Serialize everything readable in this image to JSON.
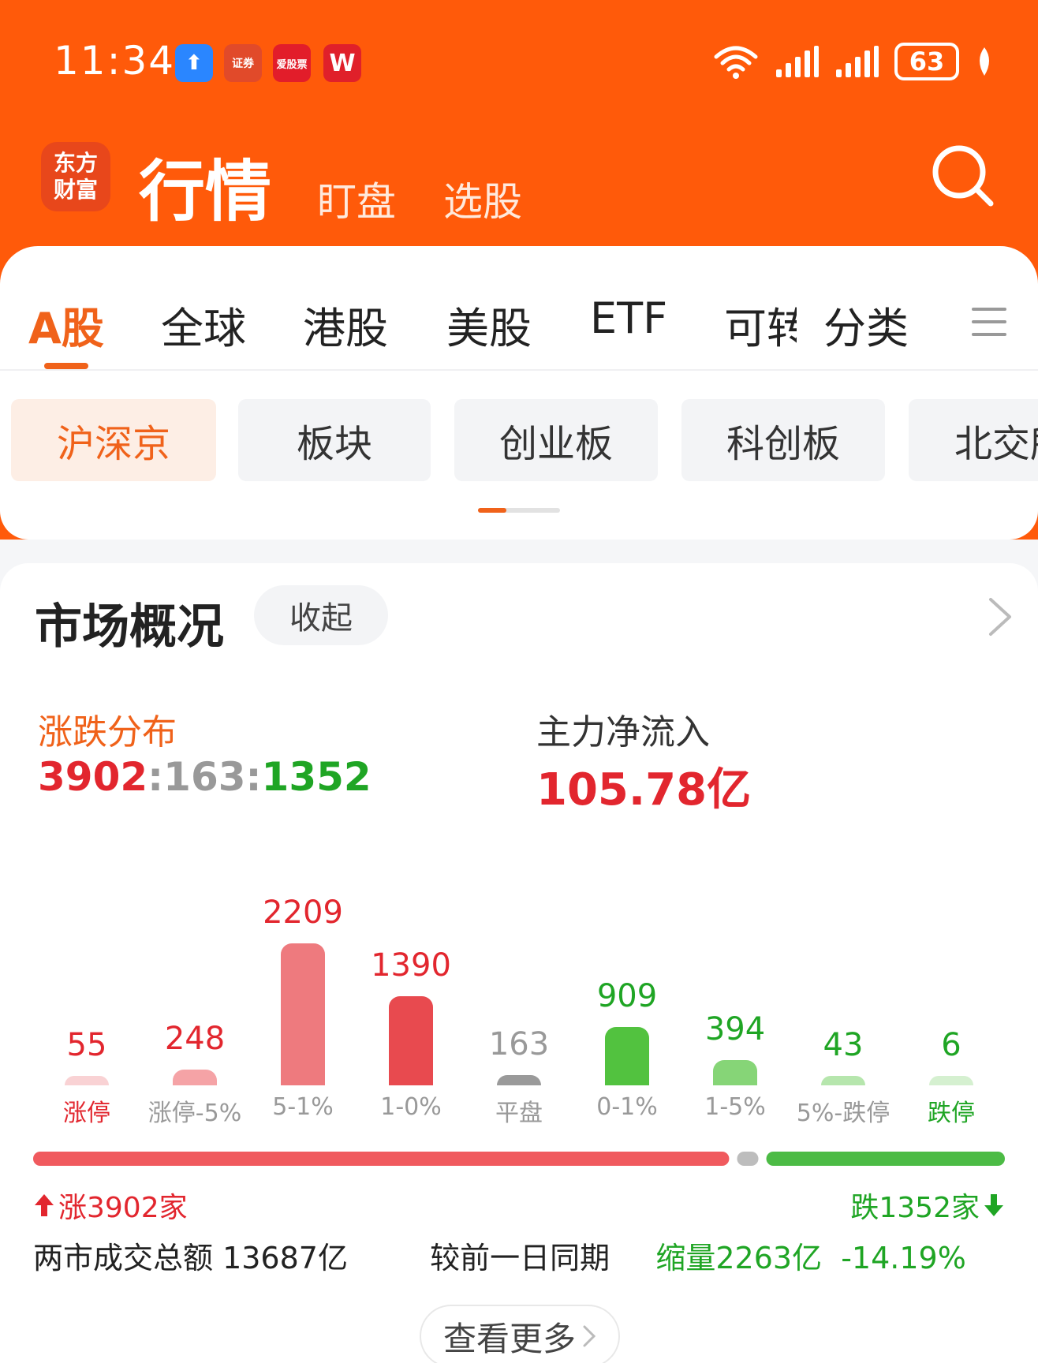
{
  "status_bar": {
    "time": "11:34",
    "app_icons": [
      {
        "name": "upload-icon",
        "label": "⬆",
        "color": "#2a86ff"
      },
      {
        "name": "zhengquan-app-icon",
        "label": "证券",
        "color": "#e14a2a"
      },
      {
        "name": "aigupiao-app-icon",
        "label": "爱股票",
        "color": "#e21d2a"
      },
      {
        "name": "w-app-icon",
        "label": "W",
        "color": "#e0202a"
      }
    ],
    "battery": "63"
  },
  "header": {
    "logo_line1": "东方",
    "logo_line2": "财富",
    "title": "行情",
    "sub_tabs": [
      "盯盘",
      "选股"
    ]
  },
  "market_tabs": [
    "A股",
    "全球",
    "港股",
    "美股",
    "ETF",
    "可转",
    "分类"
  ],
  "active_market_tab": "A股",
  "sub_chips": [
    "沪深京",
    "板块",
    "创业板",
    "科创板",
    "北交所"
  ],
  "overview": {
    "title": "市场概况",
    "collapse_label": "收起",
    "distribution_label": "涨跌分布",
    "distribution_up": "3902",
    "distribution_sep1": ":",
    "distribution_flat": "163",
    "distribution_sep2": ":",
    "distribution_down": "1352",
    "inflow_label": "主力净流入",
    "inflow_value": "105.78亿",
    "up_total": "涨3902家",
    "down_total": "跌1352家",
    "turnover_label": "两市成交总额 13687亿",
    "compare_label": "较前一日同期",
    "compare_value": "缩量2263亿  -14.19%",
    "more_label": "查看更多"
  },
  "chart_data": {
    "type": "bar",
    "categories": [
      "涨停",
      "涨停-5%",
      "5-1%",
      "1-0%",
      "平盘",
      "0-1%",
      "1-5%",
      "5%-跌停",
      "跌停"
    ],
    "values": [
      55,
      248,
      2209,
      1390,
      163,
      909,
      394,
      43,
      6
    ],
    "colors": [
      "#f9d2d4",
      "#f5a3a6",
      "#ee7a7e",
      "#e84a4f",
      "#9a9a9a",
      "#52c23f",
      "#86d577",
      "#b6e6ad",
      "#d5f0d0"
    ],
    "label_colors": [
      "#e2262e",
      "#e2262e",
      "#e2262e",
      "#e2262e",
      "#999999",
      "#1fa524",
      "#1fa524",
      "#1fa524",
      "#1fa524"
    ],
    "category_colors": [
      "#e2262e",
      "#999999",
      "#999999",
      "#999999",
      "#999999",
      "#999999",
      "#999999",
      "#999999",
      "#1fa524"
    ],
    "ratio": {
      "up": 3902,
      "flat": 163,
      "down": 1352
    }
  }
}
